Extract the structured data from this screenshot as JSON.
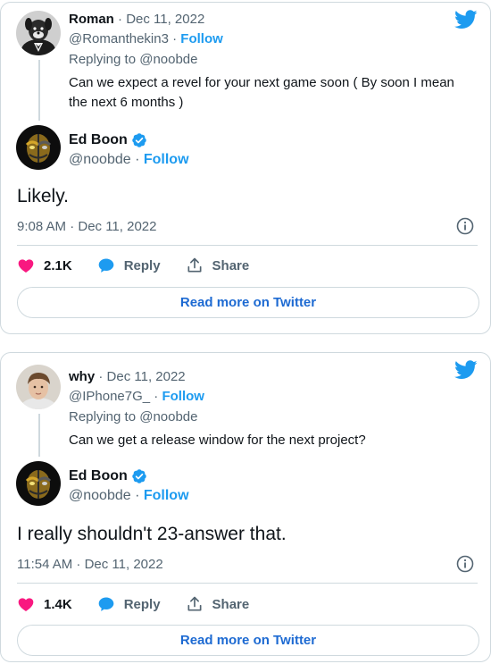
{
  "tweets": [
    {
      "reply": {
        "name": "Roman",
        "date": "Dec 11, 2022",
        "handle": "@Romanthekin3",
        "follow": "Follow",
        "replying_to": "Replying to @noobde",
        "text": "Can we expect a revel for your next game soon ( By soon I mean the next 6 months )"
      },
      "author": {
        "name": "Ed Boon",
        "handle": "@noobde",
        "follow": "Follow"
      },
      "text": "Likely.",
      "timestamp": "9:08 AM · Dec 11, 2022",
      "likes": "2.1K",
      "reply_label": "Reply",
      "share_label": "Share",
      "read_more": "Read more on Twitter"
    },
    {
      "reply": {
        "name": "why",
        "date": "Dec 11, 2022",
        "handle": "@IPhone7G_",
        "follow": "Follow",
        "replying_to": "Replying to @noobde",
        "text": "Can we get a release window for the next project?"
      },
      "author": {
        "name": "Ed Boon",
        "handle": "@noobde",
        "follow": "Follow"
      },
      "text": "I really shouldn't 23-answer that.",
      "timestamp": "11:54 AM · Dec 11, 2022",
      "likes": "1.4K",
      "reply_label": "Reply",
      "share_label": "Share",
      "read_more": "Read more on Twitter"
    }
  ],
  "icons": {
    "brand": "twitter-bird-icon",
    "verified": "verified-badge-icon",
    "info": "info-icon",
    "like": "heart-icon",
    "reply": "speech-bubble-icon",
    "share": "share-upload-icon"
  },
  "colors": {
    "twitter_blue": "#1d9bf0",
    "link_blue": "#1d6ad2",
    "like_pink": "#f91880",
    "text": "#0f1419",
    "muted": "#536471",
    "border": "#cfd9de"
  }
}
